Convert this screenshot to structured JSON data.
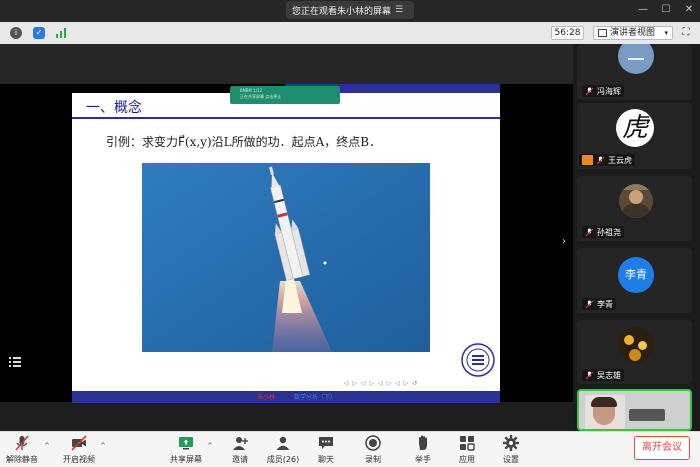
{
  "banner": {
    "text": "您正在观看朱小林的屏幕"
  },
  "infobar": {
    "timer": "56:28",
    "view_mode": "演讲者视图"
  },
  "slide": {
    "title": "一、概念",
    "overlay_line1": "BNBM 1/12",
    "overlay_line2": "正在共享屏幕 点击停止",
    "text": "引例：求变力F⃗(x,y)沿L所做的功．起点A，终点B．",
    "nav_glyphs": "◁ ▷ ◁ ▷ ◁ ▷ ◁ ▷ ↺",
    "footer_left": "朱小林",
    "footer_right": "数学分析（下）"
  },
  "participants": [
    {
      "name": "冯海辉",
      "avatar": "circle"
    },
    {
      "name": "王云虎",
      "avatar": "calligraphy",
      "avatar_text": "虎"
    },
    {
      "name": "孙祖尧",
      "avatar": "photo"
    },
    {
      "name": "李青",
      "avatar": "initials",
      "avatar_text": "李青"
    },
    {
      "name": "吴志雄",
      "avatar": "photo"
    },
    {
      "name": "",
      "avatar": "video"
    }
  ],
  "toolbar": {
    "unmute": "解除静音",
    "start_video": "开启视频",
    "share_screen": "共享屏幕",
    "invite": "邀请",
    "participants": "成员(26)",
    "chat": "聊天",
    "record": "录制",
    "raise_hand": "举手",
    "apps": "应用",
    "settings": "设置",
    "leave": "离开会议"
  },
  "colors": {
    "slide_blue": "#2b3190",
    "title_blue": "#1a1aa0",
    "leave_red": "#e24a4a",
    "mic_red": "#d83a3a",
    "li_qing_avatar": "#1e7ee6"
  }
}
